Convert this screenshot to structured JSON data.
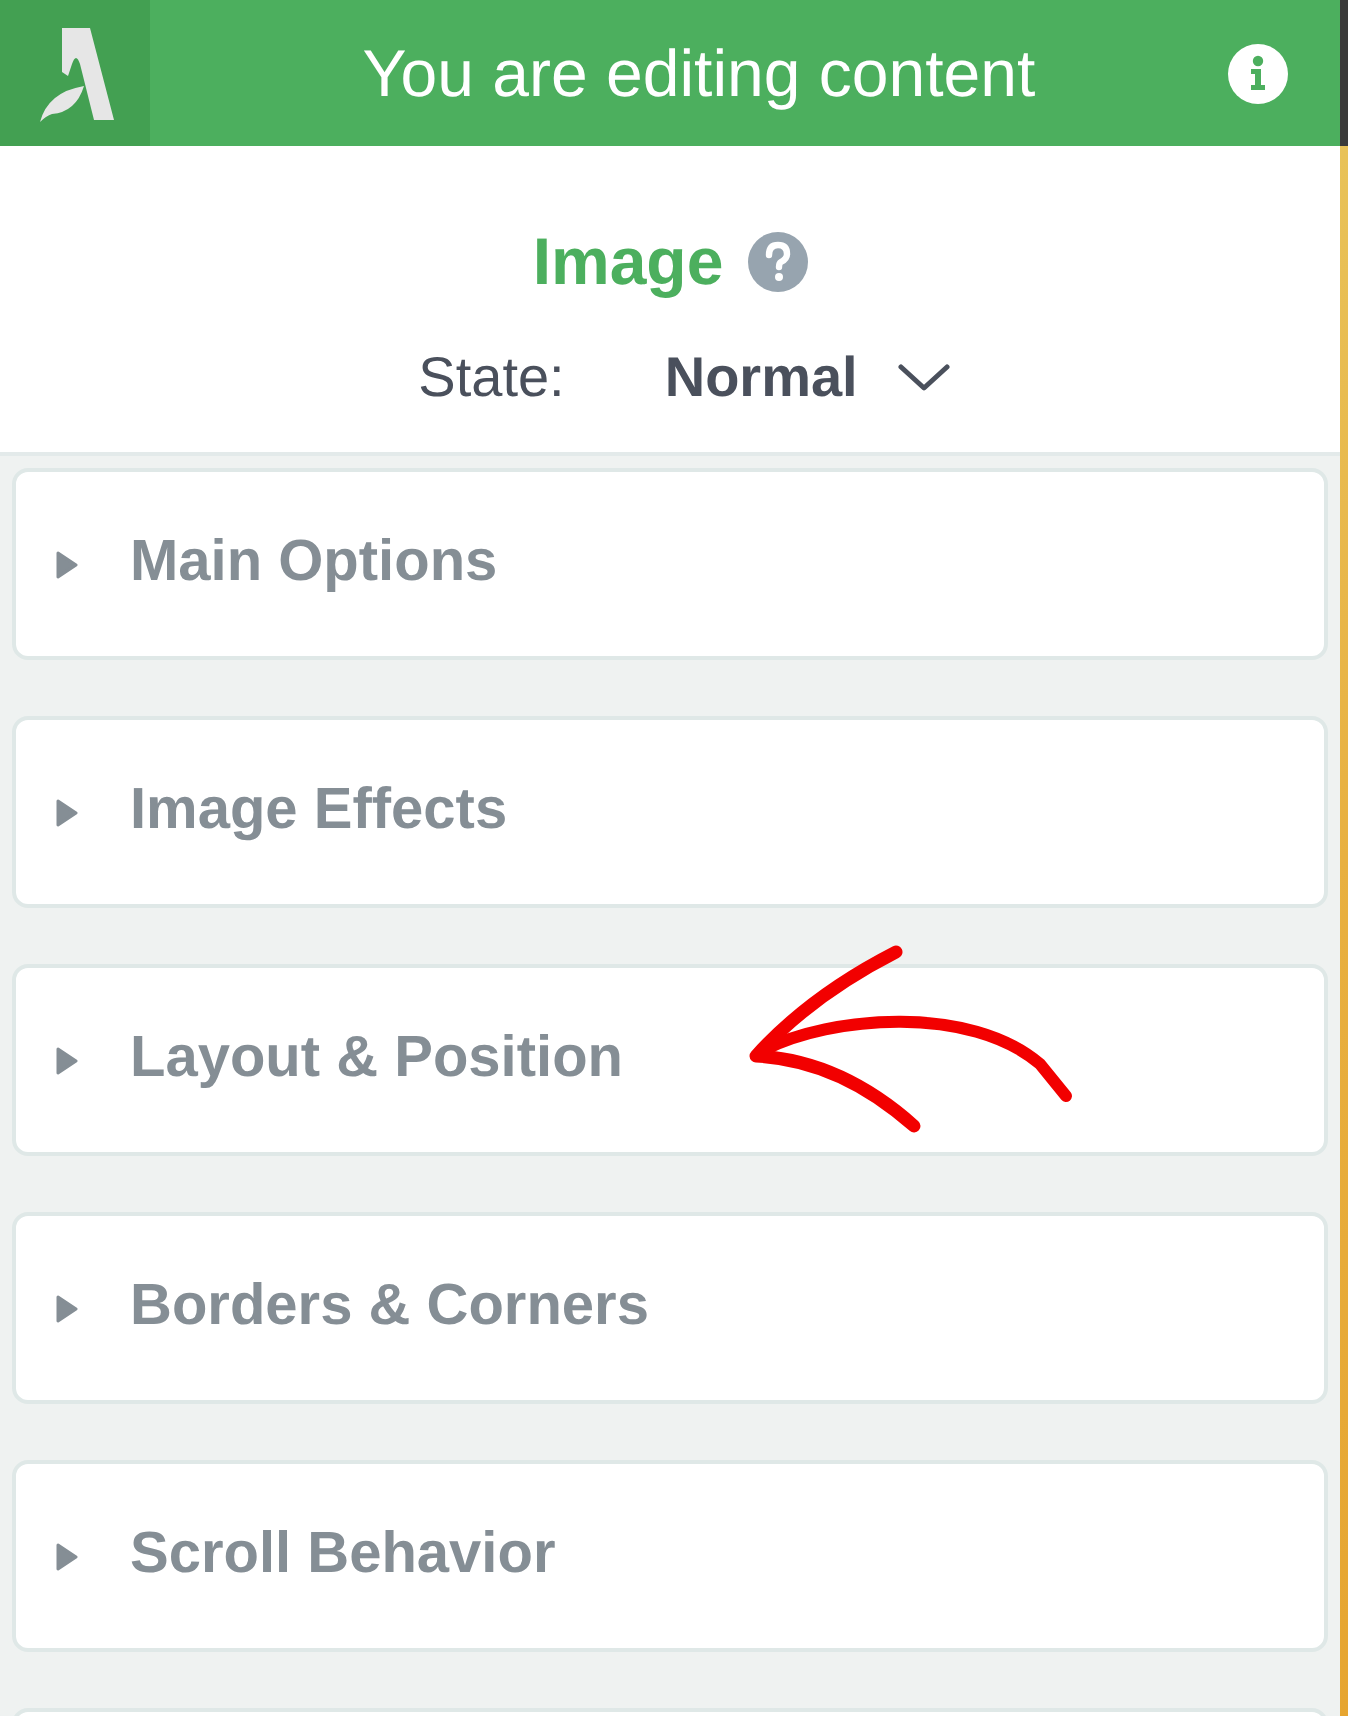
{
  "header": {
    "title": "You are editing content"
  },
  "element": {
    "title": "Image"
  },
  "state": {
    "label": "State:",
    "value": "Normal"
  },
  "sections": [
    {
      "title": "Main Options",
      "expanded": false
    },
    {
      "title": "Image Effects",
      "expanded": false
    },
    {
      "title": "Layout & Position",
      "expanded": false
    },
    {
      "title": "Borders & Corners",
      "expanded": false
    },
    {
      "title": "Scroll Behavior",
      "expanded": false
    }
  ]
}
